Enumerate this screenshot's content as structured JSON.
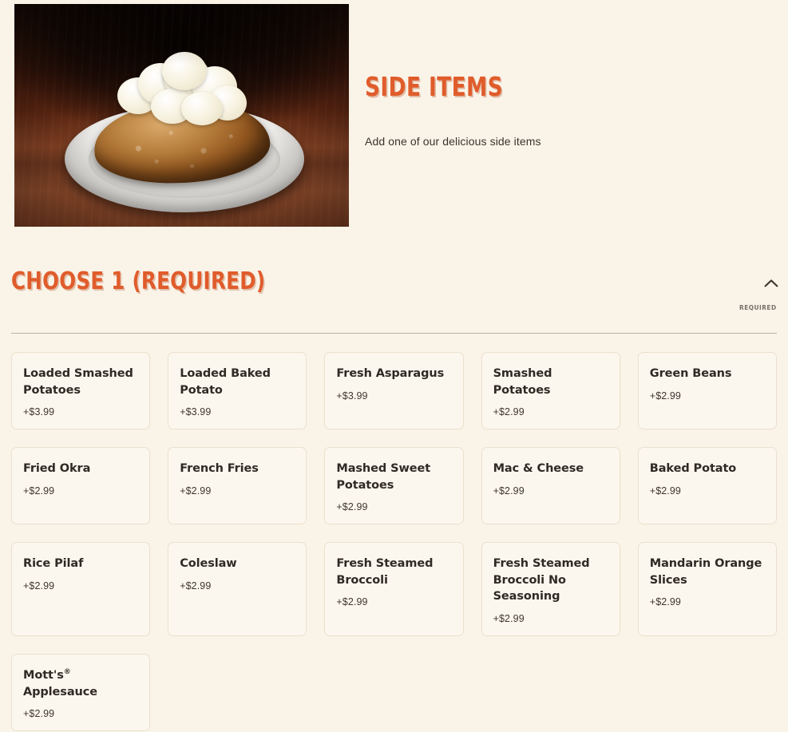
{
  "hero": {
    "image_alt": "baked-potato-with-butter-on-white-plate",
    "title": "SIDE ITEMS",
    "subtitle": "Add one of our delicious side items"
  },
  "section": {
    "title": "CHOOSE 1 (REQUIRED)",
    "required_label": "REQUIRED",
    "collapse_icon": "chevron-up-icon",
    "expanded": true
  },
  "colors": {
    "page_background": "#faf3e8",
    "accent_orange": "#e05c2b",
    "title_shadow": "#c17a56",
    "card_background": "#fcf7ee",
    "card_border": "#ece0cd",
    "divider": "#bdb1a0",
    "text_dark": "#2f2a24",
    "text_muted": "#77706a"
  },
  "options": [
    {
      "name": "Loaded Smashed Potatoes",
      "price": "+$3.99"
    },
    {
      "name": "Loaded Baked Potato",
      "price": "+$3.99"
    },
    {
      "name": "Fresh Asparagus",
      "price": "+$3.99"
    },
    {
      "name": "Smashed Potatoes",
      "price": "+$2.99"
    },
    {
      "name": "Green Beans",
      "price": "+$2.99"
    },
    {
      "name": "Fried Okra",
      "price": "+$2.99"
    },
    {
      "name": "French Fries",
      "price": "+$2.99"
    },
    {
      "name": "Mashed Sweet Potatoes",
      "price": "+$2.99"
    },
    {
      "name": "Mac & Cheese",
      "price": "+$2.99"
    },
    {
      "name": "Baked Potato",
      "price": "+$2.99"
    },
    {
      "name": "Rice Pilaf",
      "price": "+$2.99"
    },
    {
      "name": "Coleslaw",
      "price": "+$2.99"
    },
    {
      "name": "Fresh Steamed Broccoli",
      "price": "+$2.99"
    },
    {
      "name": "Fresh Steamed Broccoli No Seasoning",
      "price": "+$2.99"
    },
    {
      "name": "Mandarin Orange Slices",
      "price": "+$2.99"
    },
    {
      "name": "Mott's® Applesauce",
      "price": "+$2.99",
      "trademark": true,
      "base": "Mott's",
      "rest": "Applesauce"
    }
  ]
}
